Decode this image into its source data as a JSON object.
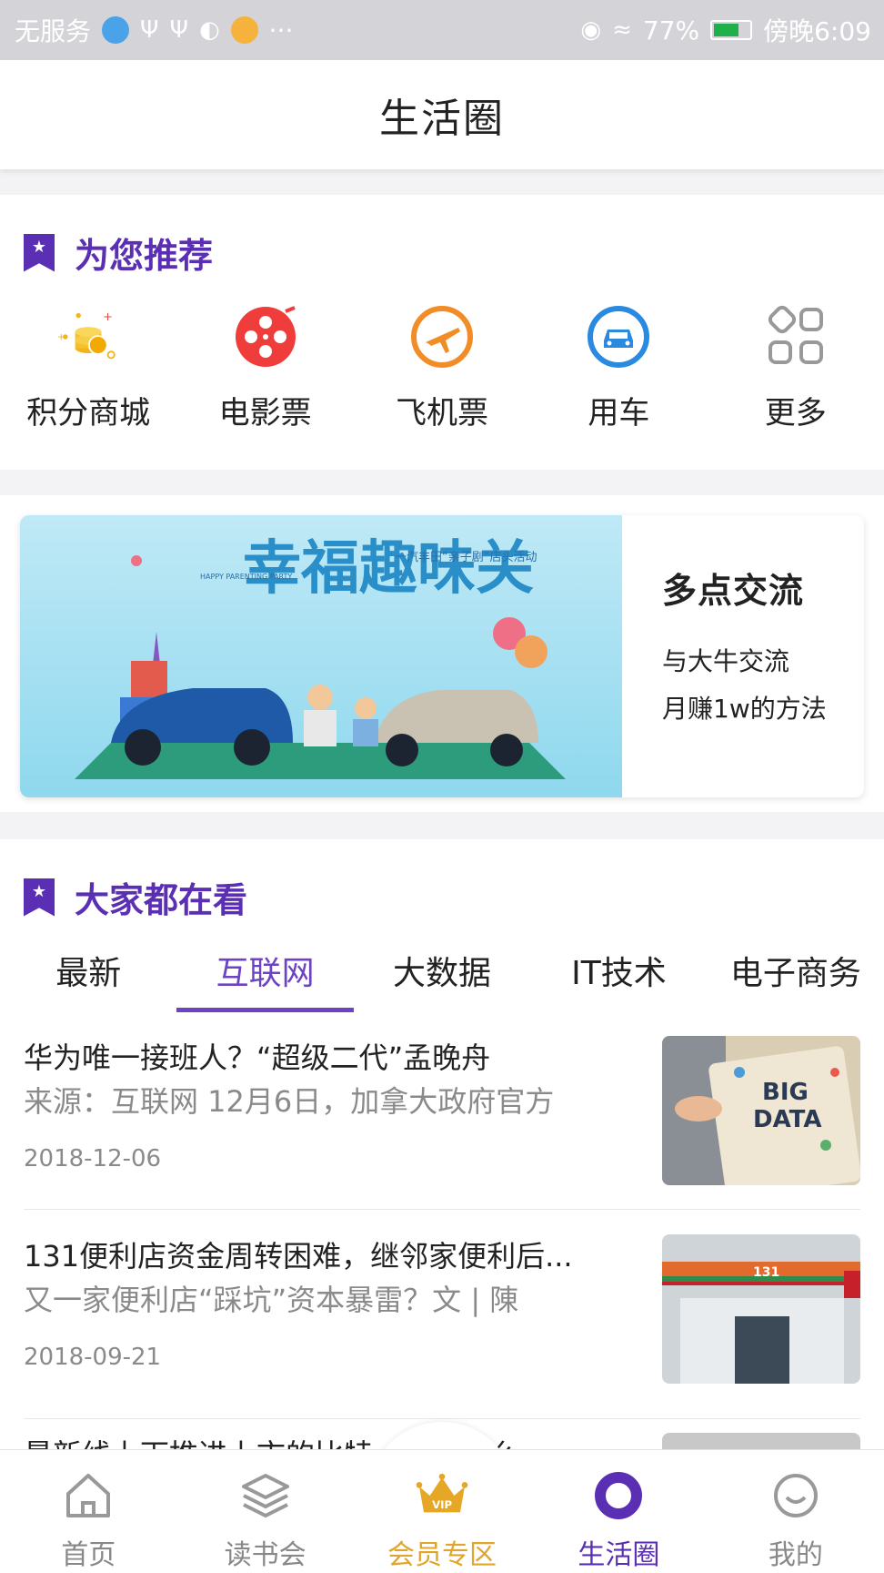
{
  "status_bar": {
    "carrier": "无服务",
    "left_extra": "···",
    "battery_percent": "77%",
    "time": "傍晚6:09"
  },
  "header": {
    "title": "生活圈"
  },
  "recommend": {
    "title": "为您推荐",
    "items": [
      {
        "label": "积分商城",
        "icon": "points-coins-icon"
      },
      {
        "label": "电影票",
        "icon": "film-reel-icon"
      },
      {
        "label": "飞机票",
        "icon": "airplane-icon"
      },
      {
        "label": "用车",
        "icon": "car-icon"
      },
      {
        "label": "更多",
        "icon": "grid-more-icon"
      }
    ]
  },
  "banner": {
    "image_heading": "幸福趣味关",
    "image_small_text": "一汽丰田“亲子剧”店头活动",
    "image_party_text": "HAPPY PARENTING PARTY",
    "title": "多点交流",
    "line1": "与大牛交流",
    "line2": "月赚1w的方法"
  },
  "popular": {
    "title": "大家都在看",
    "tabs": [
      "最新",
      "互联网",
      "大数据",
      "IT技术",
      "电子商务"
    ],
    "active_tab": 1,
    "news": [
      {
        "title": "华为唯一接班人？“超级二代”孟晚舟",
        "subtitle": "来源：互联网 12月6日，加拿大政府官方",
        "date": "2018-12-06",
        "thumb_text_1": "BIG",
        "thumb_text_2": "DATA"
      },
      {
        "title": "131便利店资金周转困难，继邻家便利后...",
        "subtitle": "又一家便利店“踩坑”资本暴雷？文 | 陳",
        "date": "2018-09-21",
        "thumb_text_1": "131"
      },
      {
        "title": "最新线上下推进上市的比特……为什么",
        "subtitle": "",
        "date": ""
      }
    ]
  },
  "nav": {
    "items": [
      {
        "label": "首页",
        "icon": "home-icon"
      },
      {
        "label": "读书会",
        "icon": "layers-icon"
      },
      {
        "label": "会员专区",
        "icon": "vip-crown-icon"
      },
      {
        "label": "生活圈",
        "icon": "ring-icon"
      },
      {
        "label": "我的",
        "icon": "profile-face-icon"
      }
    ],
    "vip_badge": "VIP",
    "active_index": 3,
    "colors": {
      "active": "#5b2fb3",
      "vip": "#e0a52a",
      "inactive": "#888888"
    }
  }
}
